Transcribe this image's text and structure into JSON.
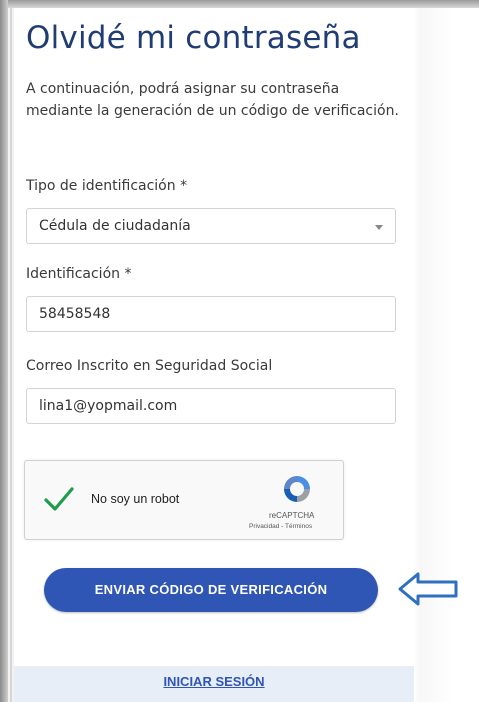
{
  "form": {
    "title": "Olvidé mi contraseña",
    "intro": "A continuación, podrá asignar su contraseña mediante la generación de un código de verificación.",
    "id_type": {
      "label": "Tipo de identificación *",
      "value": "Cédula de ciudadanía"
    },
    "id_number": {
      "label": "Identificación *",
      "value": "58458548"
    },
    "email": {
      "label": "Correo Inscrito en Seguridad Social",
      "value": "lina1@yopmail.com"
    },
    "captcha": {
      "text": "No soy un robot",
      "brand": "reCAPTCHA",
      "links": "Privacidad - Términos",
      "checked": true
    },
    "send_button": "ENVIAR CÓDIGO DE VERIFICACIÓN",
    "login_link": "INICIAR SESIÓN"
  },
  "icons": {
    "check": "checkmark-icon",
    "recaptcha": "recaptcha-logo-icon",
    "arrow": "left-arrow-icon"
  },
  "colors": {
    "title": "#1f3d74",
    "button": "#2f55b5",
    "check": "#1e9e4a",
    "arrow": "#2f6fbf",
    "login_bar": "#e8eef8"
  }
}
